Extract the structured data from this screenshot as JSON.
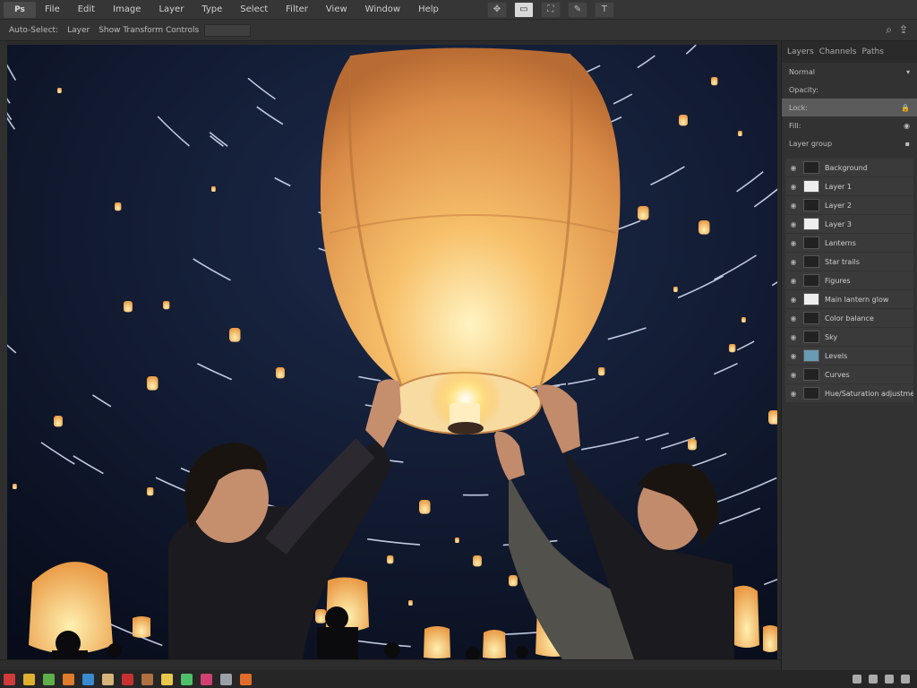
{
  "app": {
    "logo": "Ps"
  },
  "menubar": {
    "items": [
      "File",
      "Edit",
      "Image",
      "Layer",
      "Type",
      "Select",
      "Filter",
      "View",
      "Window",
      "Help"
    ],
    "tools": [
      {
        "icon": "move-icon",
        "glyph": "✥"
      },
      {
        "icon": "select-icon",
        "glyph": "▭",
        "active": true
      },
      {
        "icon": "crop-icon",
        "glyph": "⛶"
      },
      {
        "icon": "brush-icon",
        "glyph": "✎"
      },
      {
        "icon": "text-icon",
        "glyph": "T"
      }
    ]
  },
  "optbar": {
    "items": [
      "Auto-Select:",
      "Layer",
      "Show Transform Controls"
    ],
    "right_icons": [
      {
        "icon": "search-icon",
        "glyph": "⌕"
      },
      {
        "icon": "share-icon",
        "glyph": "⇪"
      }
    ]
  },
  "panel": {
    "tabs": [
      "Layers",
      "Channels",
      "Paths"
    ],
    "props": [
      {
        "label": "Normal",
        "icon": "chevron-down-icon",
        "glyph": "▾"
      },
      {
        "label": "Opacity:"
      },
      {
        "label": "Lock:",
        "highlight": true,
        "icon": "lock-icon",
        "glyph": "🔒"
      },
      {
        "label": "Fill:",
        "icon": "lock-icon",
        "glyph": "◉"
      },
      {
        "label": "Layer group",
        "icon": "folder-icon",
        "glyph": "▪"
      }
    ],
    "layers": [
      {
        "name": "Background",
        "thumb": "dark"
      },
      {
        "name": "Layer 1",
        "thumb": "white"
      },
      {
        "name": "Layer 2",
        "thumb": "dark"
      },
      {
        "name": "Layer 3",
        "thumb": "white"
      },
      {
        "name": "Lanterns",
        "thumb": "dark"
      },
      {
        "name": "Star trails",
        "thumb": "dark"
      },
      {
        "name": "Figures",
        "thumb": "dark"
      },
      {
        "name": "Main lantern glow",
        "thumb": "white"
      },
      {
        "name": "Color balance",
        "thumb": "dark"
      },
      {
        "name": "Sky",
        "thumb": "dark"
      },
      {
        "name": "Levels",
        "thumb": "blue"
      },
      {
        "name": "Curves",
        "thumb": "dark"
      },
      {
        "name": "Hue/Saturation adjustment",
        "thumb": "dark"
      }
    ]
  },
  "taskbar": {
    "apps": [
      {
        "name": "app-red",
        "color": "#d23b3b"
      },
      {
        "name": "app-yellow",
        "color": "#e0b030"
      },
      {
        "name": "app-green",
        "color": "#5fae4a"
      },
      {
        "name": "app-orange",
        "color": "#e07b2a"
      },
      {
        "name": "app-blue",
        "color": "#3a8ad0"
      },
      {
        "name": "app-beige",
        "color": "#d7b37a"
      },
      {
        "name": "app-red2",
        "color": "#c63030"
      },
      {
        "name": "app-brown",
        "color": "#b07040"
      },
      {
        "name": "app-yellow2",
        "color": "#e8c84a"
      },
      {
        "name": "app-green2",
        "color": "#4fbf6a"
      },
      {
        "name": "app-pink",
        "color": "#d04070"
      },
      {
        "name": "app-gray",
        "color": "#9aa0a6"
      },
      {
        "name": "app-orange2",
        "color": "#e06b2a"
      }
    ]
  }
}
